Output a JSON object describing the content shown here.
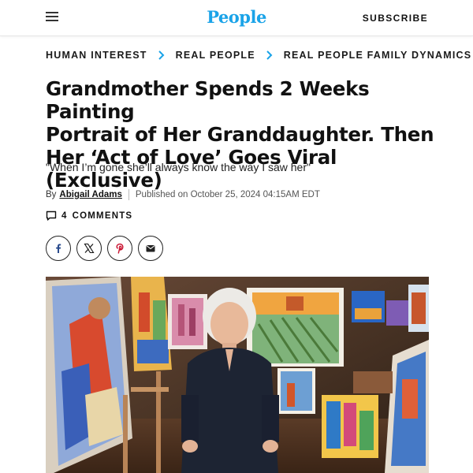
{
  "header": {
    "menu_icon": "hamburger-menu-icon",
    "logo": "People",
    "subscribe": "SUBSCRIBE"
  },
  "breadcrumb": [
    {
      "label": "HUMAN INTEREST"
    },
    {
      "label": "REAL PEOPLE"
    },
    {
      "label": "REAL PEOPLE FAMILY DYNAMICS"
    }
  ],
  "article": {
    "headline_line1": "Grandmother Spends 2 Weeks Painting",
    "headline_line2": "Portrait of Her Granddaughter. Then",
    "headline_line3": "Her ‘Act of Love’ Goes Viral (Exclusive)",
    "subheadline": "\"When I’m gone she’ll always know the way I saw her\"",
    "by": "By",
    "author": "Abigail Adams",
    "published": "Published on October 25, 2024 04:15AM EDT",
    "comments_count": "4",
    "comments_label": "COMMENTS"
  },
  "share": {
    "icons": [
      "facebook-icon",
      "x-icon",
      "pinterest-icon",
      "email-icon"
    ]
  },
  "colors": {
    "brand": "#1aa3e8",
    "text": "#111111"
  }
}
